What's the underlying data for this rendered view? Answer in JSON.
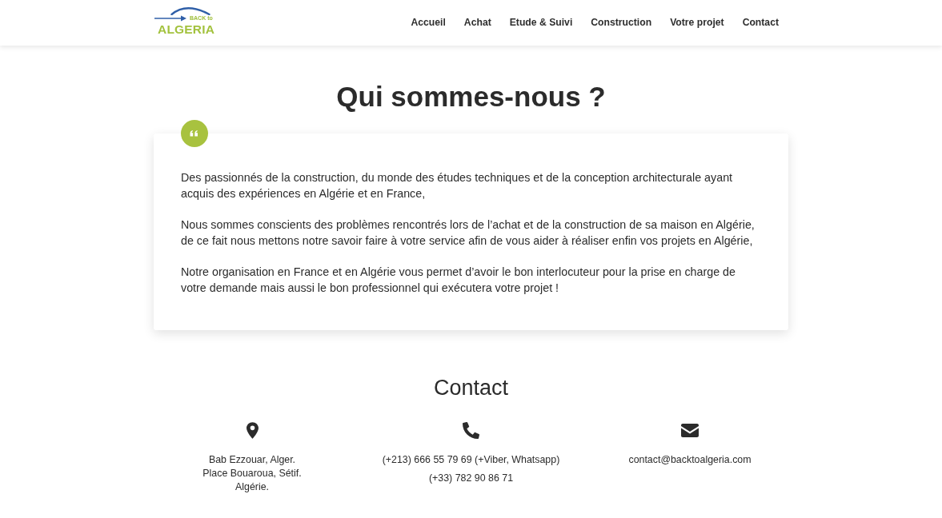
{
  "navbar": {
    "logo": {
      "tagline": "BACK to",
      "wordmark": "ALGERIA"
    },
    "links": [
      {
        "label": "Accueil"
      },
      {
        "label": "Achat"
      },
      {
        "label": "Etude & Suivi"
      },
      {
        "label": "Construction"
      },
      {
        "label": "Votre projet"
      },
      {
        "label": "Contact"
      }
    ]
  },
  "about": {
    "title": "Qui sommes-nous ?",
    "paragraphs": [
      {
        "lines": [
          "Des passionnés de la construction, du monde des études techniques et de la conception architecturale ayant",
          "acquis des expériences en Algérie et en France,"
        ]
      },
      {
        "lines": [
          "Nous sommes conscients des problèmes rencontrés lors de l’achat et de la construction de sa maison en Algérie,",
          "de ce fait nous mettons notre savoir faire à votre service afin de vous aider à réaliser enfin vos projets en Algérie,"
        ]
      },
      {
        "lines": [
          "Notre organisation en France et en Algérie vous permet d’avoir le bon interlocuteur pour la prise en charge de",
          "votre demande mais aussi le bon professionnel qui exécutera votre projet !"
        ]
      }
    ]
  },
  "contact": {
    "title": "Contact",
    "items": [
      {
        "kind": "address",
        "lines": [
          "Bab Ezzouar, Alger.",
          "Place Bouaroua, Sétif.",
          "Algérie."
        ]
      },
      {
        "kind": "phone",
        "lines": [
          "(+213) 666 55 79 69 (+Viber, Whatsapp)",
          "(+33) 782 90 86 71"
        ]
      },
      {
        "kind": "email",
        "lines": [
          "contact@backtoalgeria.com"
        ]
      }
    ]
  }
}
